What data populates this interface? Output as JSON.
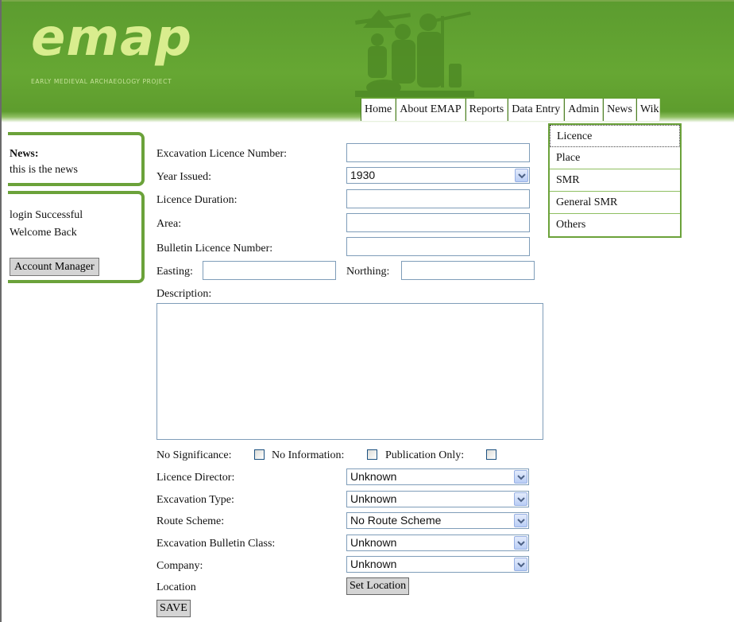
{
  "header": {
    "logo_text": "emap",
    "logo_subtitle": "EARLY MEDIEVAL ARCHAEOLOGY PROJECT"
  },
  "nav": {
    "items": [
      "Home",
      "About EMAP",
      "Reports",
      "Data Entry",
      "Admin",
      "News",
      "Wiki"
    ]
  },
  "dropdown": {
    "items": [
      "Licence",
      "Place",
      "SMR",
      "General SMR",
      "Others"
    ]
  },
  "sidebar": {
    "news_title": "News:",
    "news_text": "this is the news",
    "login_line1": "login Successful",
    "login_line2": "Welcome Back",
    "account_button": "Account Manager"
  },
  "form": {
    "licence_number_label": "Excavation Licence Number:",
    "licence_number_value": "",
    "year_issued_label": "Year Issued:",
    "year_issued_value": "1930",
    "licence_duration_label": "Licence Duration:",
    "licence_duration_value": "",
    "area_label": "Area:",
    "area_value": "",
    "bulletin_number_label": "Bulletin Licence Number:",
    "bulletin_number_value": "",
    "easting_label": "Easting:",
    "easting_value": "",
    "northing_label": "Northing:",
    "northing_value": "",
    "description_label": "Description:",
    "description_value": "",
    "no_significance_label": "No Significance:",
    "no_information_label": "No Information:",
    "publication_only_label": "Publication Only:",
    "no_significance_checked": false,
    "no_information_checked": false,
    "publication_only_checked": false,
    "licence_director_label": "Licence Director:",
    "licence_director_value": "Unknown",
    "excavation_type_label": "Excavation Type:",
    "excavation_type_value": "Unknown",
    "route_scheme_label": "Route Scheme:",
    "route_scheme_value": "No Route Scheme",
    "bulletin_class_label": "Excavation Bulletin Class:",
    "bulletin_class_value": "Unknown",
    "company_label": "Company:",
    "company_value": "Unknown",
    "location_label": "Location",
    "set_location_button": "Set Location",
    "save_button": "SAVE"
  },
  "colors": {
    "header_green": "#66a733",
    "logo_text": "#d9ed8e",
    "box_border": "#6ba23a"
  }
}
